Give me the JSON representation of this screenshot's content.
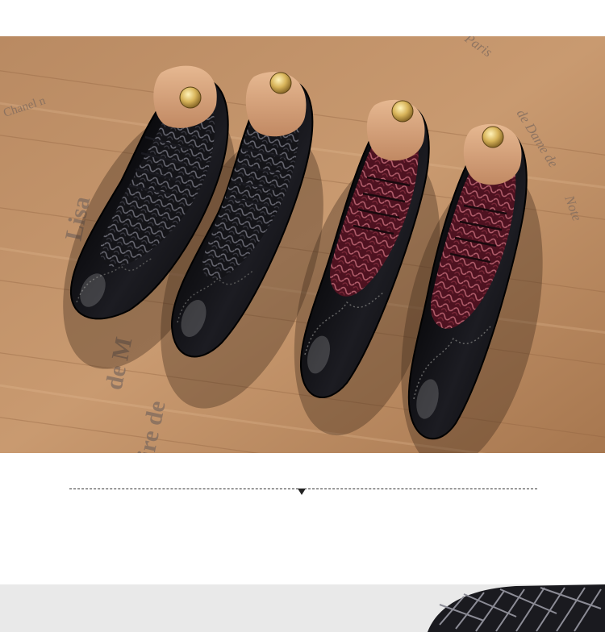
{
  "photo": {
    "wood_text": {
      "chanel": "Chanel n",
      "lisa": "Lisa",
      "fragment_de": "de M",
      "fragment_ire": "ire de",
      "paris": "Paris",
      "dame": "de Dame de",
      "note": "Note"
    }
  },
  "colors": {
    "wood_light": "#c4946a",
    "wood_dark": "#8a5a3a",
    "patent_black": "#0d0d10",
    "burgundy": "#6e1e2c",
    "shoe_tree": "#d9a47d",
    "brass_knob": "#d8b45a"
  }
}
